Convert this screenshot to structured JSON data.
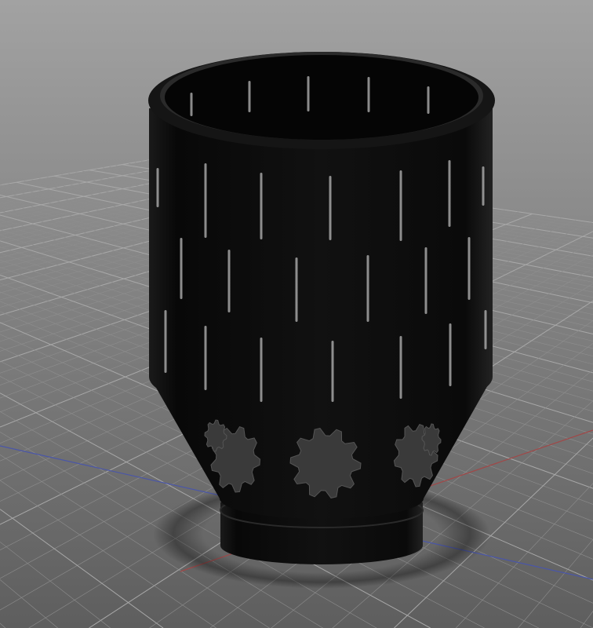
{
  "viewport": {
    "background_top": "#a2a2a2",
    "background_bottom": "#5e5e5e",
    "grid_minor_color": "#8e8e8e",
    "grid_major_color": "#a8a8a8",
    "axis_x_color": "#a04848",
    "axis_z_color": "#4a56a8"
  },
  "model": {
    "body_color": "#0e0e0e",
    "slot_color": "#b8b8b8",
    "gear_cutout_color": "#3a3a3a"
  }
}
